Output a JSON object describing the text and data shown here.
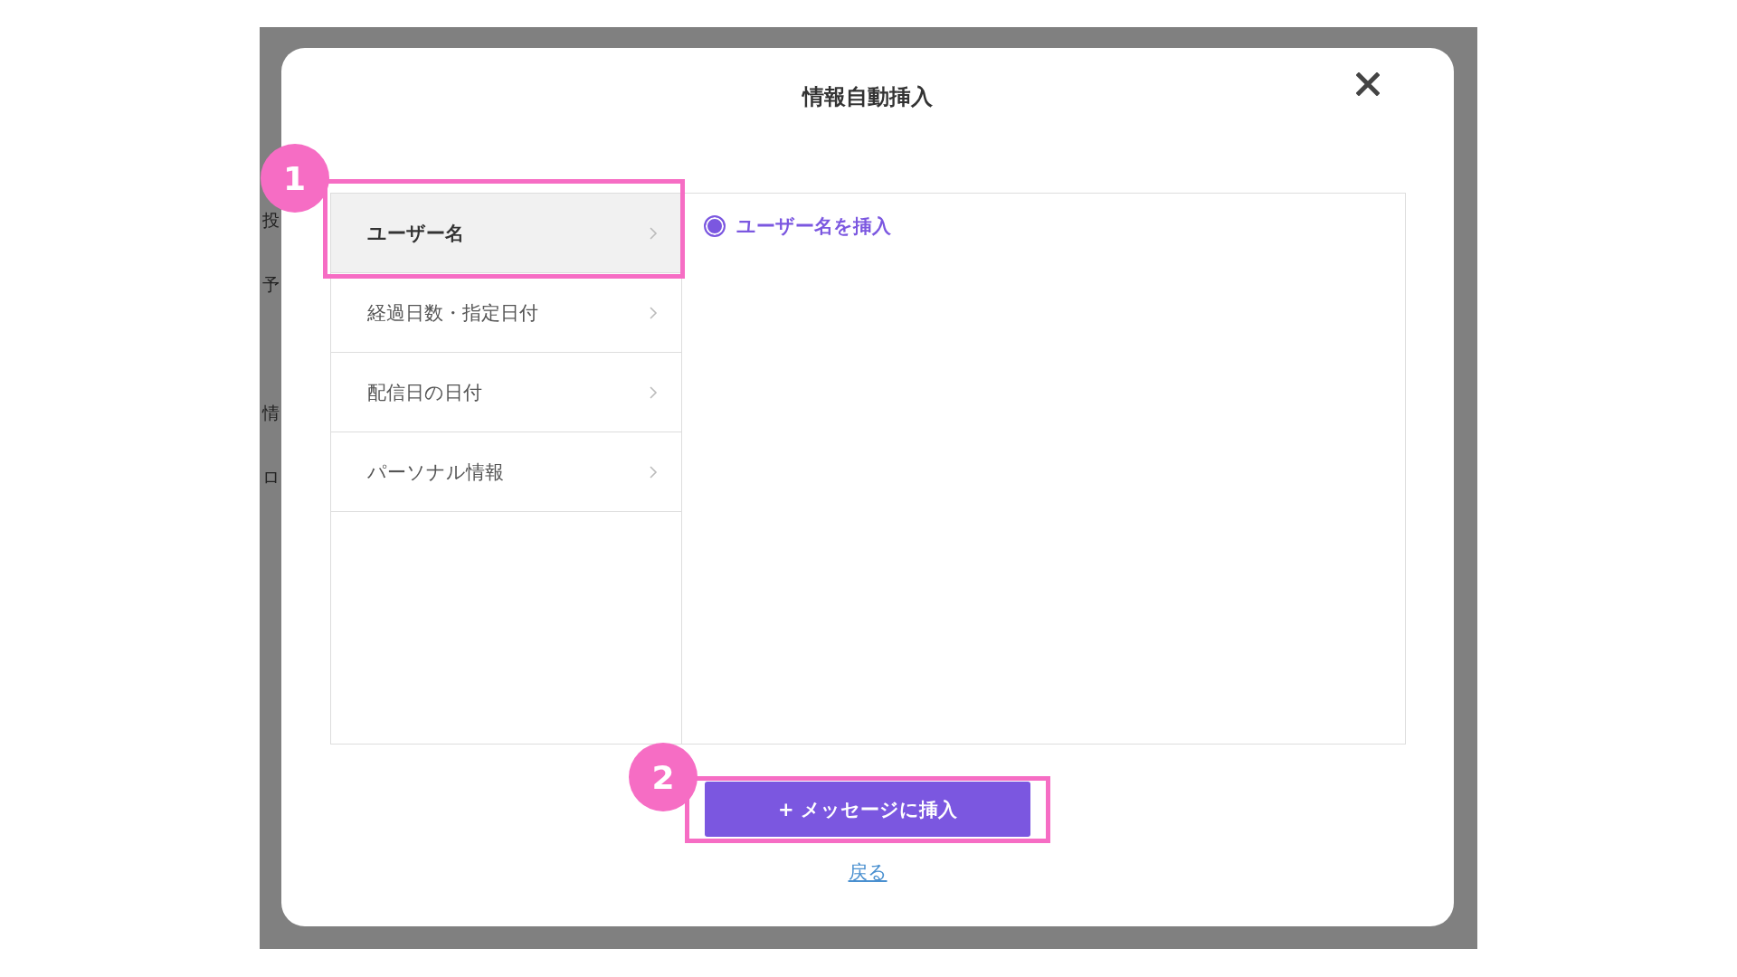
{
  "title": "情報自動挿入",
  "background_sidebar": [
    "投",
    "予",
    "情",
    "ロ"
  ],
  "menu": [
    {
      "label": "ユーザー名",
      "selected": true
    },
    {
      "label": "経過日数・指定日付",
      "selected": false
    },
    {
      "label": "配信日の日付",
      "selected": false
    },
    {
      "label": "パーソナル情報",
      "selected": false
    }
  ],
  "options": [
    {
      "label": "ユーザー名を挿入",
      "selected": true
    }
  ],
  "insert_button": "+ メッセージに挿入",
  "back_link": "戻る",
  "menu_step_badge": "1",
  "button_step_badge": "2"
}
